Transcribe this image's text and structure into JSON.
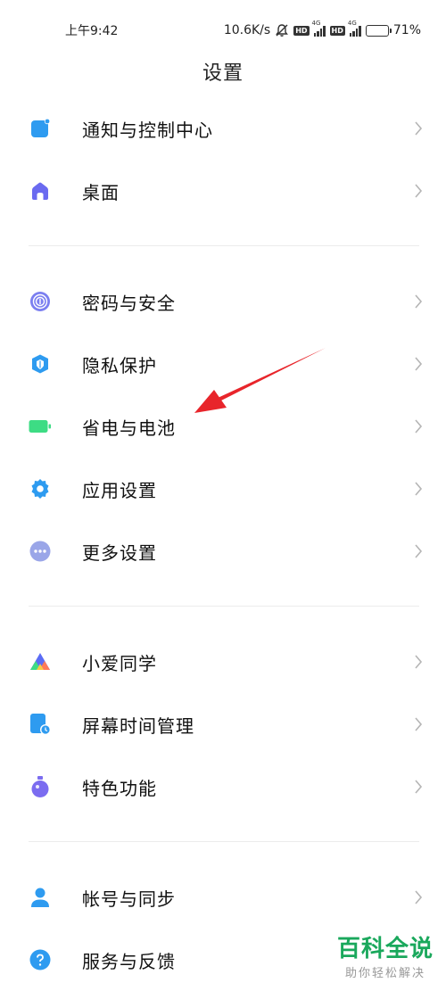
{
  "status_bar": {
    "time": "上午9:42",
    "net_speed": "10.6K/s",
    "hd_badge": "HD",
    "lte_label": "4G",
    "battery": "71%",
    "battery_level": 0.71
  },
  "title": "设置",
  "groups": [
    {
      "items": [
        {
          "label": "通知与控制中心",
          "icon": "notification-icon",
          "color": "#2e9bf0"
        },
        {
          "label": "桌面",
          "icon": "home-icon",
          "color": "#6a6af0"
        }
      ]
    },
    {
      "items": [
        {
          "label": "密码与安全",
          "icon": "fingerprint-icon",
          "color": "#7b7ff0"
        },
        {
          "label": "隐私保护",
          "icon": "privacy-shield-icon",
          "color": "#2e9bf0"
        },
        {
          "label": "省电与电池",
          "icon": "battery-icon",
          "color": "#3ddc84"
        },
        {
          "label": "应用设置",
          "icon": "gear-icon",
          "color": "#2e9bf0"
        },
        {
          "label": "更多设置",
          "icon": "more-dots-icon",
          "color": "#9aa6e8"
        }
      ]
    },
    {
      "items": [
        {
          "label": "小爱同学",
          "icon": "xiaoai-icon",
          "color": "#5b6cf5"
        },
        {
          "label": "屏幕时间管理",
          "icon": "screen-time-icon",
          "color": "#2e9bf0"
        },
        {
          "label": "特色功能",
          "icon": "feature-flask-icon",
          "color": "#7b6cf0"
        }
      ]
    },
    {
      "items": [
        {
          "label": "帐号与同步",
          "icon": "account-icon",
          "color": "#2e9bf0"
        },
        {
          "label": "服务与反馈",
          "icon": "help-icon",
          "color": "#2e9bf0"
        }
      ]
    }
  ],
  "annotation": {
    "color": "#e8252b"
  },
  "watermark": {
    "main": "百科全说",
    "sub": "助你轻松解决"
  }
}
